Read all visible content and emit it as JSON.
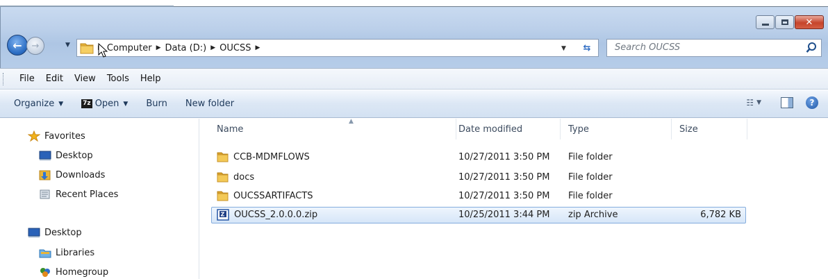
{
  "window": {
    "controls": {
      "minimize": "minimize",
      "maximize": "maximize",
      "close": "x"
    }
  },
  "nav": {
    "breadcrumbs": [
      "Computer",
      "Data (D:)",
      "OUCSS"
    ],
    "search_placeholder": "Search OUCSS"
  },
  "menu": [
    "File",
    "Edit",
    "View",
    "Tools",
    "Help"
  ],
  "toolbar": {
    "organize": "Organize",
    "sevenzip_badge": "7z",
    "open": "Open",
    "burn": "Burn",
    "new_folder": "New folder"
  },
  "sidebar": {
    "favorites_header": "Favorites",
    "favorites": [
      {
        "label": "Desktop",
        "icon": "desktop-icon"
      },
      {
        "label": "Downloads",
        "icon": "downloads-folder-icon"
      },
      {
        "label": "Recent Places",
        "icon": "recent-places-icon"
      }
    ],
    "tree": [
      {
        "label": "Desktop",
        "icon": "desktop-icon"
      },
      {
        "label": "Libraries",
        "icon": "libraries-icon"
      },
      {
        "label": "Homegroup",
        "icon": "homegroup-icon"
      }
    ]
  },
  "columns": {
    "name": "Name",
    "date": "Date modified",
    "type": "Type",
    "size": "Size"
  },
  "files": [
    {
      "name": "CCB-MDMFLOWS",
      "date": "10/27/2011 3:50 PM",
      "type": "File folder",
      "size": "",
      "icon": "folder-icon"
    },
    {
      "name": "docs",
      "date": "10/27/2011 3:50 PM",
      "type": "File folder",
      "size": "",
      "icon": "folder-icon"
    },
    {
      "name": "OUCSSARTIFACTS",
      "date": "10/27/2011 3:50 PM",
      "type": "File folder",
      "size": "",
      "icon": "folder-icon"
    },
    {
      "name": "OUCSS_2.0.0.0.zip",
      "date": "10/25/2011 3:44 PM",
      "type": "zip Archive",
      "size": "6,782 KB",
      "icon": "zip-archive-icon",
      "selected": true
    }
  ],
  "colors": {
    "accent": "#2c6ec4",
    "selection_border": "#84acdd",
    "folder": "#e8b53a"
  }
}
